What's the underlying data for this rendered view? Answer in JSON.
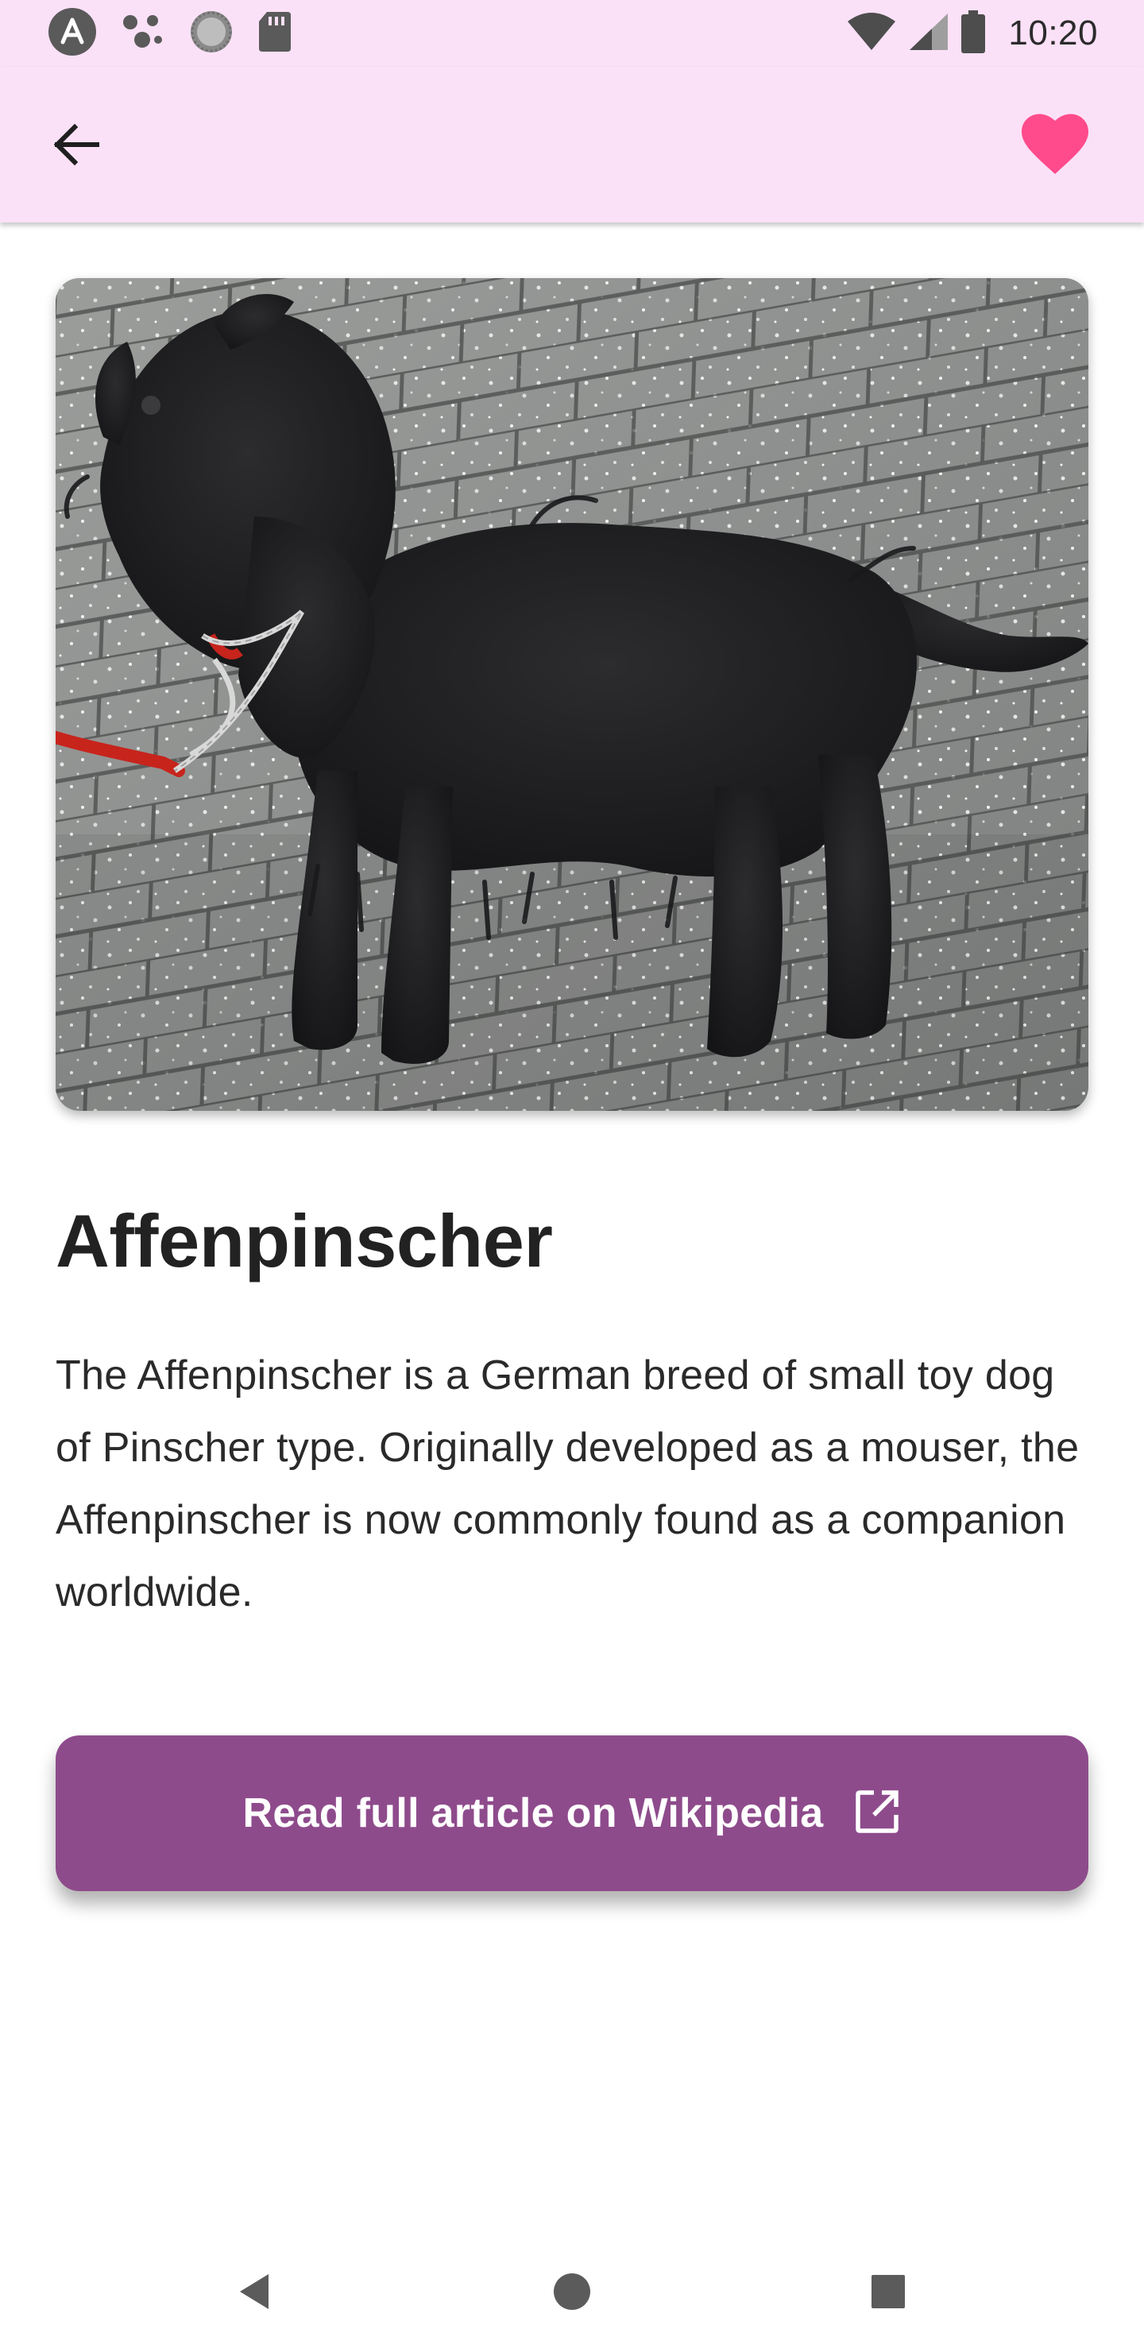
{
  "status_bar": {
    "time": "10:20",
    "left_icons": [
      "app-notification-icon",
      "assistant-dots-icon",
      "sync-circle-icon",
      "sd-card-icon"
    ],
    "right_icons": [
      "wifi-icon",
      "cellular-signal-icon",
      "battery-icon"
    ]
  },
  "app_bar": {
    "back_icon": "arrow-back-icon",
    "favorite_icon": "heart-icon",
    "favorite_active": true,
    "favorite_color": "#ff4b8b"
  },
  "breed": {
    "name": "Affenpinscher",
    "description": "The Affenpinscher is a German breed of small toy dog of Pinscher type. Originally developed as a mouser, the Affenpinscher is now commonly found as a companion worldwide.",
    "image_subject": "black dog on paving stones"
  },
  "wiki_button": {
    "label": "Read full article on Wikipedia",
    "icon": "open-in-new-icon",
    "color": "#8e4b8c"
  },
  "nav_bar": {
    "back_icon": "nav-back-triangle-icon",
    "home_icon": "nav-home-circle-icon",
    "recents_icon": "nav-recents-square-icon"
  },
  "colors": {
    "header_background": "#fbe1f8",
    "title_text": "#222222",
    "body_text": "#2a2a2a"
  }
}
